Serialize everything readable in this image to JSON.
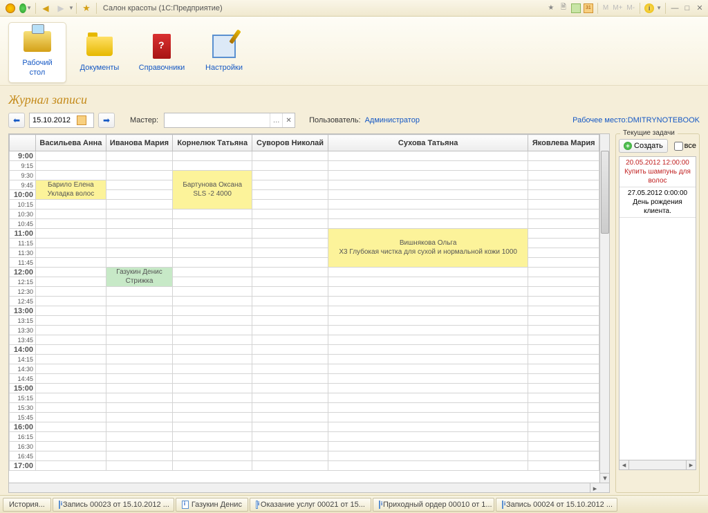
{
  "title_bar": {
    "app_title": "Салон красоты  (1С:Предприятие)",
    "cal31": "31",
    "mem": [
      "M",
      "M+",
      "M-"
    ],
    "info": "i"
  },
  "toolbar": {
    "desktop": "Рабочий\nстол",
    "documents": "Документы",
    "references": "Справочники",
    "settings": "Настройки"
  },
  "page": {
    "title": "Журнал записи",
    "date": "15.10.2012",
    "master_label": "Мастер:",
    "user_label": "Пользователь:",
    "user_value": " Администратор",
    "workplace_label": "Рабочее место:",
    "workplace_value": "DMITRYNOTEBOOK"
  },
  "schedule": {
    "masters": [
      "Васильева Анна",
      "Иванова Мария",
      "Корнелюк Татьяна",
      "Суворов Николай",
      "Сухова Татьяна",
      "Яковлева Мария"
    ],
    "times": [
      "9:00",
      "9:15",
      "9:30",
      "9:45",
      "10:00",
      "10:15",
      "10:30",
      "10:45",
      "11:00",
      "11:15",
      "11:30",
      "11:45",
      "12:00",
      "12:15",
      "12:30",
      "12:45",
      "13:00",
      "13:15",
      "13:30",
      "13:45",
      "14:00",
      "14:15",
      "14:30",
      "14:45",
      "15:00",
      "15:15",
      "15:30",
      "15:45",
      "16:00",
      "16:15",
      "16:30",
      "16:45",
      "17:00"
    ],
    "appointments": [
      {
        "master": 0,
        "row": 3,
        "span": 2,
        "cls": "appt-yellow",
        "line1": "Барило Елена",
        "line2": "Укладка волос"
      },
      {
        "master": 2,
        "row": 2,
        "span": 4,
        "cls": "appt-yellow",
        "line1": "Бартунова Оксана",
        "line2": "SLS -2 4000"
      },
      {
        "master": 4,
        "row": 8,
        "span": 4,
        "cls": "appt-yellow",
        "line1": "Вишнякова Ольга",
        "line2": "X3 Глубокая чистка для сухой и нормальной кожи 1000"
      },
      {
        "master": 1,
        "row": 12,
        "span": 2,
        "cls": "appt-green",
        "line1": "Газукин Денис",
        "line2": "Стрижка"
      }
    ]
  },
  "tasks": {
    "legend": "Текущие задачи",
    "create": "Создать",
    "all": "все",
    "items": [
      {
        "date": "20.05.2012 12:00:00",
        "text": "Купить шампунь для волос",
        "cls": "red"
      },
      {
        "date": "27.05.2012 0:00:00",
        "text": "День рождения клиента.",
        "cls": ""
      }
    ]
  },
  "taskbar": {
    "history": "История...",
    "tabs": [
      "Запись 00023 от 15.10.2012 ...",
      "Газукин Денис",
      "Оказание услуг 00021 от 15...",
      "Приходный ордер 00010 от 1...",
      "Запись 00024 от 15.10.2012 ..."
    ]
  }
}
